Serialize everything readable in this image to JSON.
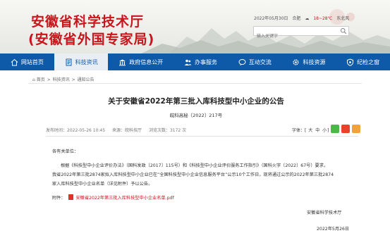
{
  "header": {
    "title_line1": "安徽省科学技术厅",
    "title_line2": "(安徽省外国专家局)",
    "date": "2022年05月30日",
    "city": "合肥",
    "temperature": "18~28℃",
    "weather": "东北风",
    "search_placeholder": "输入关键字"
  },
  "nav": {
    "items": [
      {
        "label": "网站首页",
        "icon": "home-icon"
      },
      {
        "label": "科技资讯",
        "icon": "document-icon"
      },
      {
        "label": "政府信息公开",
        "icon": "building-icon"
      },
      {
        "label": "办事服务",
        "icon": "people-icon"
      },
      {
        "label": "互动交流",
        "icon": "chat-icon"
      },
      {
        "label": "科技资源",
        "icon": "gear-icon"
      },
      {
        "label": "纪检之窗",
        "icon": "shield-icon"
      }
    ],
    "active_index": 1
  },
  "breadcrumb": {
    "items": [
      "首页",
      "科技资讯",
      "通知公告"
    ],
    "separator": ">"
  },
  "article": {
    "title": "关于安徽省2022年第三批入库科技型中小企业的公告",
    "doc_number": "皖科高秘〔2022〕217号",
    "publish_time": "发布时间：2022-05-26 10:45",
    "source": "来源：皖科技厅",
    "views": "浏览次数：3172 次",
    "font_size_label": "字体：",
    "font_size_options": [
      "大",
      "中",
      "小"
    ],
    "salutation": "各有关单位：",
    "body_line1": "根据《科技型中小企业评价办法》（国科发政〔2017〕115号）和《科技型中小企业评价服务工作指引》（国科火字〔2022〕67号）要求，",
    "body_line2": "我省2022年第三批2874家拟入库科技型中小企业已在“全国科技型中小企业信息服务平台”公示10个工作日，现将通过公示的2022年第三批2874",
    "body_line3": "家入库科技型中小企业名单（详见附件）予以公告。",
    "attachment_label": "附件：",
    "attachment_file": "安徽省2022年第三批入库科技型中小企业名单.pdf",
    "signature": "安徽省科学技术厅",
    "date": "2022年5月26日"
  },
  "colors": {
    "brand_red": "#c8161d",
    "nav_blue": "#0f5aa8"
  }
}
